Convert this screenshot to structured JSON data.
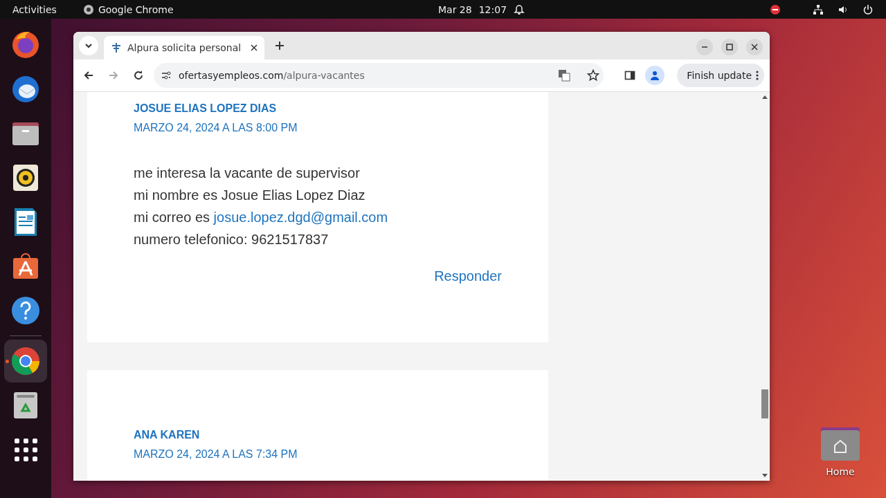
{
  "top_bar": {
    "activities": "Activities",
    "app": "Google Chrome",
    "date": "Mar 28",
    "time": "12:07"
  },
  "dock": {
    "items": [
      {
        "kind": "firefox",
        "running": false
      },
      {
        "kind": "thunderbird",
        "running": false
      },
      {
        "kind": "files",
        "running": false
      },
      {
        "kind": "rhythmbox",
        "running": false
      },
      {
        "kind": "writer",
        "running": false
      },
      {
        "kind": "appcenter",
        "running": false
      },
      {
        "kind": "help",
        "running": false
      },
      {
        "kind": "chrome",
        "running": true
      },
      {
        "kind": "trash",
        "running": false
      },
      {
        "kind": "apps",
        "running": false
      }
    ]
  },
  "browser": {
    "tabs": [
      {
        "title": "Alpura solicita personal",
        "selected": true
      }
    ],
    "url_domain": "ofertasyempleos.com",
    "url_path": "/alpura-vacantes",
    "update_button": "Finish update"
  },
  "comments": [
    {
      "author": "JOSUE ELIAS LOPEZ DIAS",
      "date": "MARZO 24, 2024 A LAS 8:00 PM",
      "lines": [
        {
          "text": "me interesa la vacante de supervisor"
        },
        {
          "text": "mi nombre es Josue Elias Lopez Diaz"
        },
        {
          "text": "mi correo es",
          "link": "josue.lopez.dgd@gmail.com"
        },
        {
          "text": "numero telefonico: 9621517837"
        }
      ],
      "reply": "Responder"
    },
    {
      "author": "ANA KAREN",
      "date": "MARZO 24, 2024 A LAS 7:34 PM"
    }
  ],
  "desktop_icons": [
    {
      "label": "Home"
    }
  ]
}
